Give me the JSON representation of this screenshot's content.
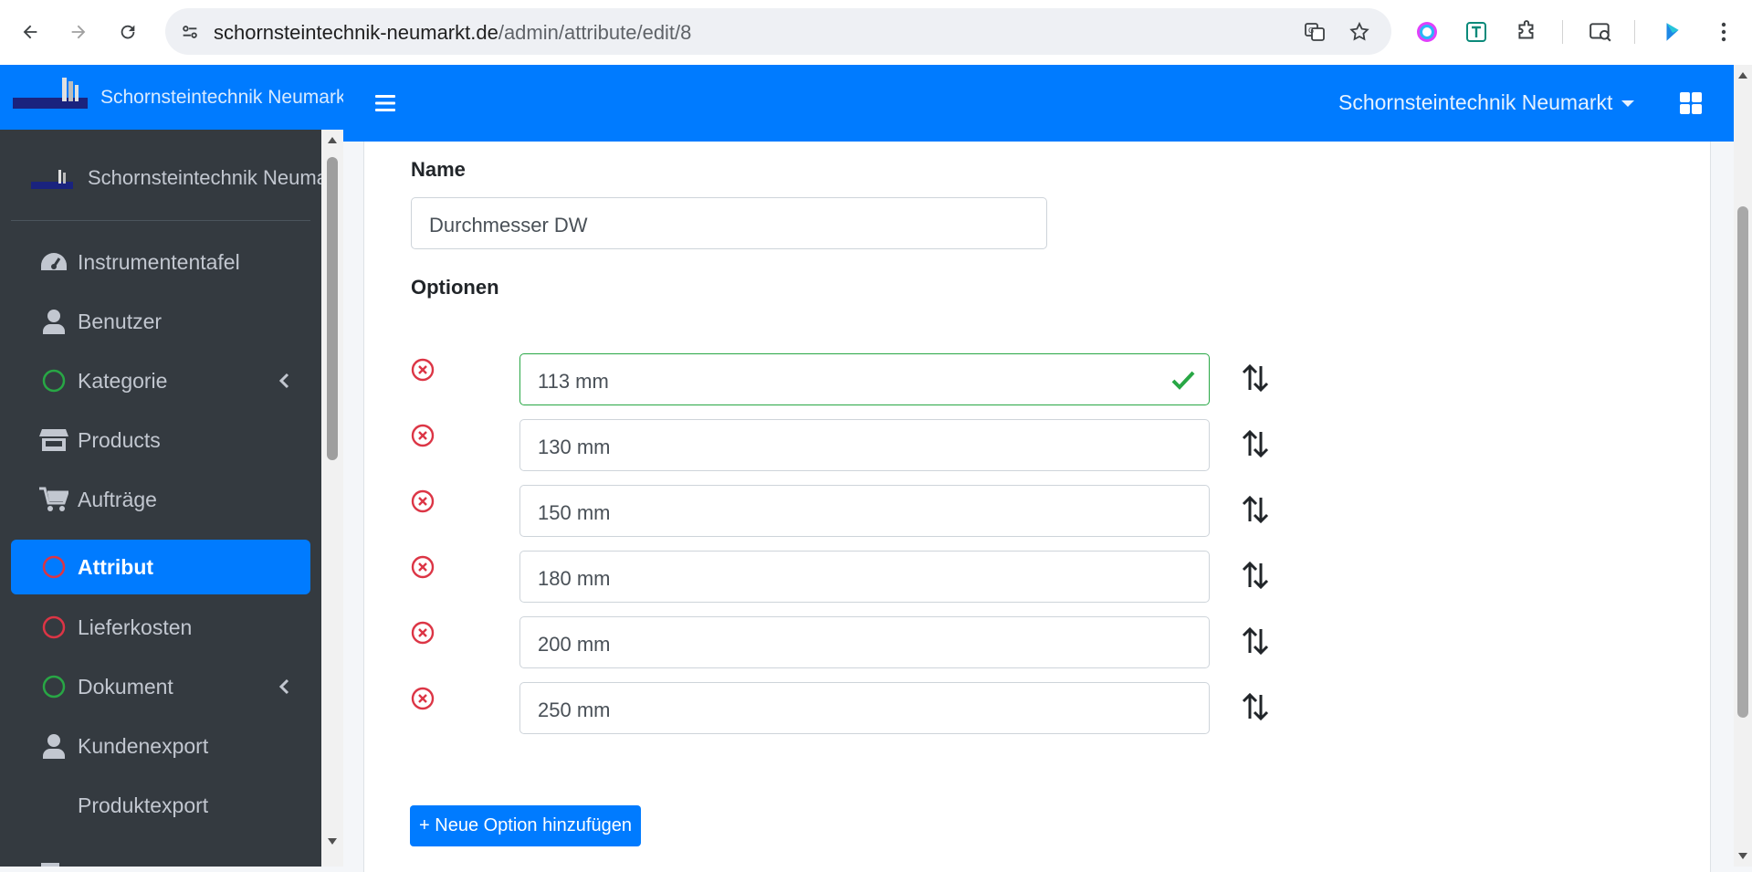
{
  "browser": {
    "url_domain": "schornsteintechnik-neumarkt.de",
    "url_path": "/admin/attribute/edit/8"
  },
  "sidebar": {
    "brand": "Schornsteintechnik Neumarkt G",
    "user_name": "Schornsteintechnik Neumarkt",
    "items": [
      {
        "label": "Instrumententafel",
        "icon": "dashboard-icon"
      },
      {
        "label": "Benutzer",
        "icon": "user-icon"
      },
      {
        "label": "Kategorie",
        "icon": "circle-outline-icon",
        "icon_color": "#28a745",
        "has_chevron": true
      },
      {
        "label": "Products",
        "icon": "store-icon"
      },
      {
        "label": "Aufträge",
        "icon": "cart-icon"
      },
      {
        "label": "Attribut",
        "icon": "circle-outline-icon",
        "icon_color": "#dc3545",
        "active": true
      },
      {
        "label": "Lieferkosten",
        "icon": "circle-outline-icon",
        "icon_color": "#dc3545"
      },
      {
        "label": "Dokument",
        "icon": "circle-outline-icon",
        "icon_color": "#28a745",
        "has_chevron": true
      },
      {
        "label": "Kundenexport",
        "icon": "user-icon"
      },
      {
        "label": "Produktexport",
        "icon": ""
      }
    ]
  },
  "topbar": {
    "user_dropdown": "Schornsteintechnik Neumarkt"
  },
  "form": {
    "name_label": "Name",
    "name_value": "Durchmesser DW",
    "options_label": "Optionen",
    "options": [
      "113 mm",
      "130 mm",
      "150 mm",
      "180 mm",
      "200 mm",
      "250 mm"
    ],
    "add_button": "+ Neue Option hinzufügen"
  },
  "colors": {
    "primary": "#007bff",
    "sidebar_bg": "#343a40",
    "danger": "#dc3545",
    "success": "#28a745"
  }
}
